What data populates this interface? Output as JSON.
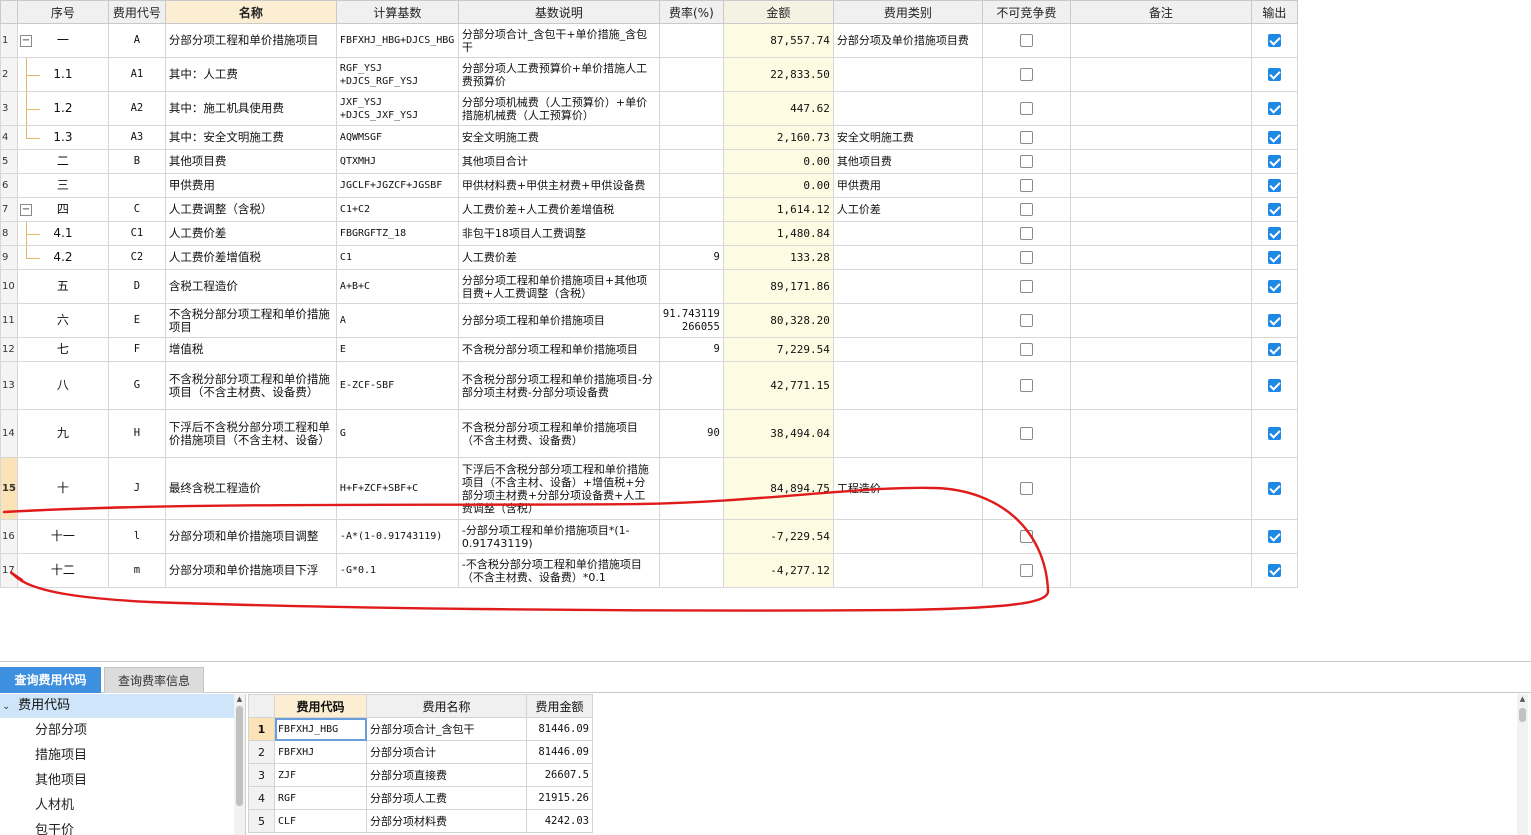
{
  "main_table": {
    "headers": [
      "序号",
      "费用代号",
      "名称",
      "计算基数",
      "基数说明",
      "费率(%)",
      "金额",
      "费用类别",
      "不可竞争费",
      "备注",
      "输出"
    ],
    "rows": [
      {
        "num": "1",
        "seq": "一",
        "code": "A",
        "name": "分部分项工程和单价措施项目",
        "base": "FBFXHJ_HBG+DJCS_HBG",
        "desc": "分部分项合计_含包干+单价措施_含包干",
        "rate": "",
        "amount": "87,557.74",
        "category": "分部分项及单价措施项目费",
        "noncomp": false,
        "remark": "",
        "output": true
      },
      {
        "num": "2",
        "seq": "1.1",
        "code": "A1",
        "name": "其中：人工费",
        "base": "RGF_YSJ +DJCS_RGF_YSJ",
        "desc": "分部分项人工费预算价+单价措施人工费预算价",
        "rate": "",
        "amount": "22,833.50",
        "category": "",
        "noncomp": false,
        "remark": "",
        "output": true
      },
      {
        "num": "3",
        "seq": "1.2",
        "code": "A2",
        "name": "其中：施工机具使用费",
        "base": "JXF_YSJ +DJCS_JXF_YSJ",
        "desc": "分部分项机械费（人工预算价）+单价措施机械费（人工预算价）",
        "rate": "",
        "amount": "447.62",
        "category": "",
        "noncomp": false,
        "remark": "",
        "output": true
      },
      {
        "num": "4",
        "seq": "1.3",
        "code": "A3",
        "name": "其中：安全文明施工费",
        "base": "AQWMSGF",
        "desc": "安全文明施工费",
        "rate": "",
        "amount": "2,160.73",
        "category": "安全文明施工费",
        "noncomp": false,
        "remark": "",
        "output": true
      },
      {
        "num": "5",
        "seq": "二",
        "code": "B",
        "name": "其他项目费",
        "base": "QTXMHJ",
        "desc": "其他项目合计",
        "rate": "",
        "amount": "0.00",
        "category": "其他项目费",
        "noncomp": false,
        "remark": "",
        "output": true
      },
      {
        "num": "6",
        "seq": "三",
        "code": "",
        "name": "甲供费用",
        "base": "JGCLF+JGZCF+JGSBF",
        "desc": "甲供材料费+甲供主材费+甲供设备费",
        "rate": "",
        "amount": "0.00",
        "category": "甲供费用",
        "noncomp": false,
        "remark": "",
        "output": true
      },
      {
        "num": "7",
        "seq": "四",
        "code": "C",
        "name": "人工费调整（含税）",
        "base": "C1+C2",
        "desc": "人工费价差+人工费价差增值税",
        "rate": "",
        "amount": "1,614.12",
        "category": "人工价差",
        "noncomp": false,
        "remark": "",
        "output": true
      },
      {
        "num": "8",
        "seq": "4.1",
        "code": "C1",
        "name": "人工费价差",
        "base": "FBGRGFTZ_18",
        "desc": "非包干18项目人工费调整",
        "rate": "",
        "amount": "1,480.84",
        "category": "",
        "noncomp": false,
        "remark": "",
        "output": true
      },
      {
        "num": "9",
        "seq": "4.2",
        "code": "C2",
        "name": "人工费价差增值税",
        "base": "C1",
        "desc": "人工费价差",
        "rate": "9",
        "amount": "133.28",
        "category": "",
        "noncomp": false,
        "remark": "",
        "output": true
      },
      {
        "num": "10",
        "seq": "五",
        "code": "D",
        "name": "含税工程造价",
        "base": "A+B+C",
        "desc": "分部分项工程和单价措施项目+其他项目费+人工费调整（含税）",
        "rate": "",
        "amount": "89,171.86",
        "category": "",
        "noncomp": false,
        "remark": "",
        "output": true
      },
      {
        "num": "11",
        "seq": "六",
        "code": "E",
        "name": "不含税分部分项工程和单价措施项目",
        "base": "A",
        "desc": "分部分项工程和单价措施项目",
        "rate": "91.743119 266055",
        "amount": "80,328.20",
        "category": "",
        "noncomp": false,
        "remark": "",
        "output": true
      },
      {
        "num": "12",
        "seq": "七",
        "code": "F",
        "name": "增值税",
        "base": "E",
        "desc": "不含税分部分项工程和单价措施项目",
        "rate": "9",
        "amount": "7,229.54",
        "category": "",
        "noncomp": false,
        "remark": "",
        "output": true
      },
      {
        "num": "13",
        "seq": "八",
        "code": "G",
        "name": "不含税分部分项工程和单价措施项目（不含主材费、设备费）",
        "base": "E-ZCF-SBF",
        "desc": "不含税分部分项工程和单价措施项目-分部分项主材费-分部分项设备费",
        "rate": "",
        "amount": "42,771.15",
        "category": "",
        "noncomp": false,
        "remark": "",
        "output": true
      },
      {
        "num": "14",
        "seq": "九",
        "code": "H",
        "name": "下浮后不含税分部分项工程和单价措施项目（不含主材、设备）",
        "base": "G",
        "desc": "不含税分部分项工程和单价措施项目（不含主材费、设备费）",
        "rate": "90",
        "amount": "38,494.04",
        "category": "",
        "noncomp": false,
        "remark": "",
        "output": true
      },
      {
        "num": "15",
        "seq": "十",
        "code": "J",
        "name": "最终含税工程造价",
        "base": "H+F+ZCF+SBF+C",
        "desc": "下浮后不含税分部分项工程和单价措施项目（不含主材、设备）+增值税+分部分项主材费+分部分项设备费+人工费调整（含税）",
        "rate": "",
        "amount": "84,894.75",
        "category": "工程造价",
        "noncomp": false,
        "remark": "",
        "output": true
      },
      {
        "num": "16",
        "seq": "十一",
        "code": "l",
        "name": "分部分项和单价措施项目调整",
        "base": "-A*(1-0.91743119)",
        "desc": "-分部分项工程和单价措施项目*(1-0.91743119)",
        "rate": "",
        "amount": "-7,229.54",
        "category": "",
        "noncomp": false,
        "remark": "",
        "output": true
      },
      {
        "num": "17",
        "seq": "十二",
        "code": "m",
        "name": "分部分项和单价措施项目下浮",
        "base": "-G*0.1",
        "desc": "-不含税分部分项工程和单价措施项目（不含主材费、设备费）*0.1",
        "rate": "",
        "amount": "-4,277.12",
        "category": "",
        "noncomp": false,
        "remark": "",
        "output": true
      }
    ]
  },
  "bottom": {
    "tabs": [
      "查询费用代码",
      "查询费率信息"
    ],
    "tree_root": "费用代码",
    "tree_items": [
      "分部分项",
      "措施项目",
      "其他项目",
      "人材机",
      "包干价"
    ],
    "code_headers": [
      "",
      "费用代码",
      "费用名称",
      "费用金额"
    ],
    "code_rows": [
      {
        "n": "1",
        "code": "FBFXHJ_HBG",
        "name": "分部分项合计_含包干",
        "value": "81446.09"
      },
      {
        "n": "2",
        "code": "FBFXHJ",
        "name": "分部分项合计",
        "value": "81446.09"
      },
      {
        "n": "3",
        "code": "ZJF",
        "name": "分部分项直接费",
        "value": "26607.5"
      },
      {
        "n": "4",
        "code": "RGF",
        "name": "分部分项人工费",
        "value": "21915.26"
      },
      {
        "n": "5",
        "code": "CLF",
        "name": "分部分项材料费",
        "value": "4242.03"
      }
    ]
  },
  "colors": {
    "accent": "#3d8fe0",
    "checkbox": "#1e88e5",
    "annotation": "#e01b1b",
    "amount_bg": "#fefbe3",
    "header_highlight": "#fbeed2"
  }
}
